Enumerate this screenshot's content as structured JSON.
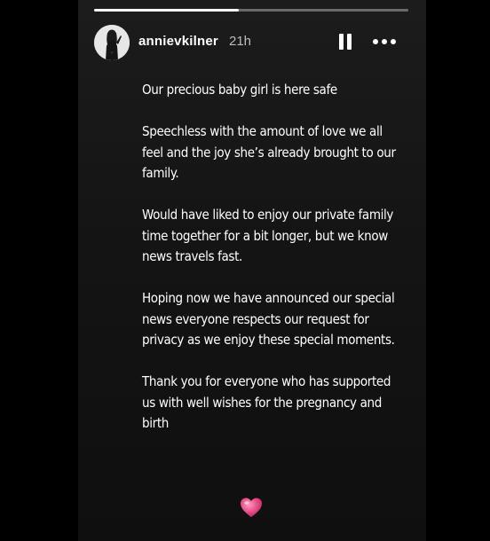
{
  "story": {
    "progress": 0.46,
    "account": {
      "username": "annievkilner",
      "time_ago": "21h",
      "avatar_icon": "profile-photo"
    },
    "controls": {
      "pause_icon": "pause-icon",
      "more_icon": "more-options-icon"
    },
    "caption": {
      "paragraphs": [
        "Our precious baby girl is here safe",
        "Speechless with the amount of love we all feel and the joy she’s already brought to our family.",
        "Would have liked to enjoy our private family time together for a bit longer, but we know news travels fast.",
        "Hoping now we have announced our special news everyone respects our request for privacy as we enjoy these special moments.",
        "Thank you for everyone who has supported us with well wishes for the pregnancy and birth"
      ]
    },
    "sticker": {
      "icon": "pink-heart-emoji",
      "color": "#e84d8a"
    }
  }
}
